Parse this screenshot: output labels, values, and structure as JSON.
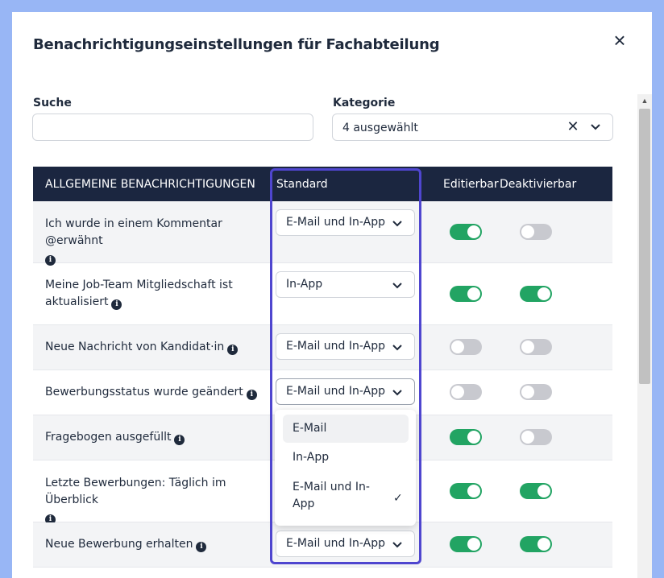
{
  "modal": {
    "title": "Benachrichtigungseinstellungen für Fachabteilung",
    "close_icon": "close-icon"
  },
  "filters": {
    "search_label": "Suche",
    "search_value": "",
    "search_placeholder": "",
    "category_label": "Kategorie",
    "category_value": "4 ausgewählt",
    "category_clear_icon": "clear-icon",
    "category_chevron_icon": "chevron-down-icon"
  },
  "table": {
    "headers": {
      "name": "ALLGEMEINE BENACHRICHTIGUNGEN",
      "standard": "Standard",
      "editable": "Editierbar",
      "deactivatable": "Deaktivierbar"
    },
    "rows": [
      {
        "label": "Ich wurde in einem Kommentar @erwähnt",
        "standard": "E-Mail und In-App",
        "editable": true,
        "deactivatable": false
      },
      {
        "label": "Meine Job-Team Mitgliedschaft ist aktualisiert",
        "standard": "In-App",
        "editable": true,
        "deactivatable": true
      },
      {
        "label": "Neue Nachricht von Kandidat·in",
        "standard": "E-Mail und In-App",
        "editable": false,
        "deactivatable": false
      },
      {
        "label": "Bewerbungsstatus wurde geändert",
        "standard": "E-Mail und In-App",
        "editable": false,
        "deactivatable": false
      },
      {
        "label": "Fragebogen ausgefüllt",
        "standard": "",
        "editable": true,
        "deactivatable": false
      },
      {
        "label": "Letzte Bewerbungen: Täglich im Überblick",
        "standard": "",
        "editable": true,
        "deactivatable": true
      },
      {
        "label": "Neue Bewerbung erhalten",
        "standard": "E-Mail und In-App",
        "editable": true,
        "deactivatable": true
      }
    ],
    "info_icon": "info-icon"
  },
  "dropdown": {
    "options": [
      "E-Mail",
      "In-App",
      "E-Mail und In-App"
    ],
    "highlighted": "E-Mail",
    "selected": "E-Mail und In-App"
  },
  "colors": {
    "header_bg": "#1b2640",
    "toggle_on": "#22a463",
    "toggle_off": "#c8c9cf",
    "highlight_border": "#4f46cf",
    "page_bg": "#98b6f5"
  }
}
